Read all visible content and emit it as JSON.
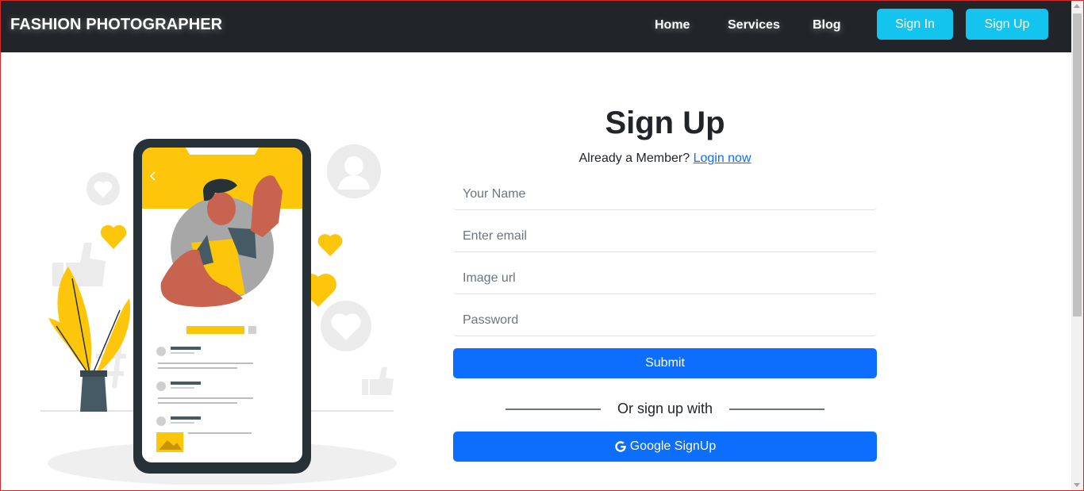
{
  "nav": {
    "brand": "FASHION PHOTOGRAPHER",
    "links": [
      "Home",
      "Services",
      "Blog"
    ],
    "sign_in": "Sign In",
    "sign_up": "Sign Up"
  },
  "form": {
    "title": "Sign Up",
    "member_text": "Already a Member?",
    "login_link": "Login now",
    "name_placeholder": "Your Name",
    "email_placeholder": "Enter email",
    "image_placeholder": "Image url",
    "password_placeholder": "Password",
    "submit": "Submit",
    "or_text": "Or sign up with",
    "google": "Google SignUp"
  },
  "colors": {
    "navbar": "#212529",
    "accent_cyan": "#13c4ef",
    "primary_blue": "#0d6efd",
    "illustration_yellow": "#fdc60b"
  },
  "icons": [
    "google-icon",
    "heart-icon",
    "user-icon",
    "thumbs-up-icon",
    "hashtag-icon"
  ]
}
